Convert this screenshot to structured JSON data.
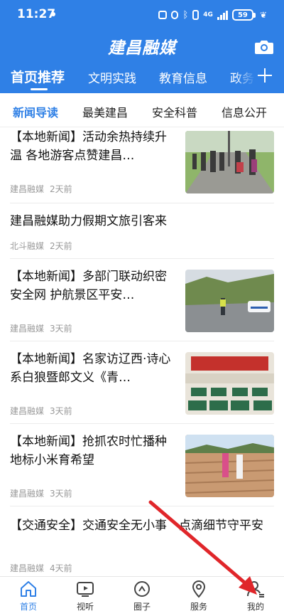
{
  "status_bar": {
    "time": "11:27",
    "network": "4G",
    "battery": "59"
  },
  "app": {
    "title": "建昌融媒",
    "camera_icon": "camera-icon"
  },
  "channel_tabs": [
    {
      "label": "首页推荐",
      "active": true
    },
    {
      "label": "文明实践",
      "active": false
    },
    {
      "label": "教育信息",
      "active": false
    },
    {
      "label": "政务",
      "active": false
    }
  ],
  "sub_tabs": [
    {
      "label": "新闻导读",
      "active": true
    },
    {
      "label": "最美建昌",
      "active": false
    },
    {
      "label": "安全科普",
      "active": false
    },
    {
      "label": "信息公开",
      "active": false
    }
  ],
  "news": [
    {
      "title": "【本地新闻】活动余热持续升温 各地游客点赞建昌…",
      "source": "建昌融媒",
      "time": "2天前",
      "image": "tourists-on-road"
    },
    {
      "title": "建昌融媒助力假期文旅引客来",
      "source": "北斗融媒",
      "time": "2天前",
      "image": ""
    },
    {
      "title": "【本地新闻】多部门联动织密安全网 护航景区平安…",
      "source": "建昌融媒",
      "time": "3天前",
      "image": "police-checkpoint"
    },
    {
      "title": "【本地新闻】名家访辽西·诗心系白狼暨郎文义《青…",
      "source": "建昌融媒",
      "time": "3天前",
      "image": "meeting-hall"
    },
    {
      "title": "【本地新闻】抢抓农时忙播种 地标小米育希望",
      "source": "建昌融媒",
      "time": "3天前",
      "image": "farm-field"
    },
    {
      "title": "【交通安全】交通安全无小事　点滴细节守平安",
      "source": "建昌融媒",
      "time": "4天前",
      "image": ""
    }
  ],
  "bottom_nav": [
    {
      "label": "首页",
      "icon": "home-icon",
      "active": true
    },
    {
      "label": "视听",
      "icon": "tv-icon",
      "active": false
    },
    {
      "label": "圈子",
      "icon": "circle-icon",
      "active": false
    },
    {
      "label": "服务",
      "icon": "location-icon",
      "active": false
    },
    {
      "label": "我的",
      "icon": "profile-icon",
      "active": false
    }
  ],
  "colors": {
    "accent": "#2f80e6",
    "annotation_arrow": "#e0262a"
  }
}
